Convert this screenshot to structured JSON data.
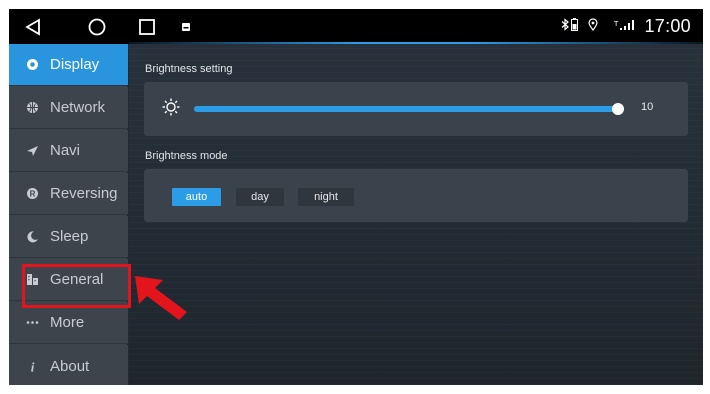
{
  "status_bar": {
    "time": "17:00",
    "icons": [
      "back-triangle-icon",
      "home-circle-icon",
      "recents-square-icon",
      "notification-icon",
      "bluetooth-icon",
      "battery-icon",
      "location-icon",
      "signal-icon"
    ]
  },
  "sidebar": {
    "items": [
      {
        "label": "Display",
        "icon": "display-icon",
        "active": true
      },
      {
        "label": "Network",
        "icon": "globe-icon",
        "active": false
      },
      {
        "label": "Navi",
        "icon": "navigation-arrow-icon",
        "active": false
      },
      {
        "label": "Reversing",
        "icon": "reverse-r-icon",
        "active": false
      },
      {
        "label": "Sleep",
        "icon": "moon-icon",
        "active": false
      },
      {
        "label": "General",
        "icon": "general-icon",
        "active": false
      },
      {
        "label": "More",
        "icon": "dots-icon",
        "active": false
      },
      {
        "label": "About",
        "icon": "info-icon",
        "active": false
      }
    ]
  },
  "main": {
    "brightness": {
      "section_label": "Brightness setting",
      "value": 10,
      "value_text": "10",
      "level_fraction": 1.0
    },
    "brightness_mode": {
      "section_label": "Brightness mode",
      "options": [
        "auto",
        "day",
        "night"
      ],
      "selected": "auto"
    }
  },
  "annotations": {
    "highlighted_item": "General",
    "highlight_color": "#e3141b"
  },
  "colors": {
    "accent": "#2b9de6",
    "sidebar_bg": "#3d444c",
    "main_bg": "#232a33"
  }
}
